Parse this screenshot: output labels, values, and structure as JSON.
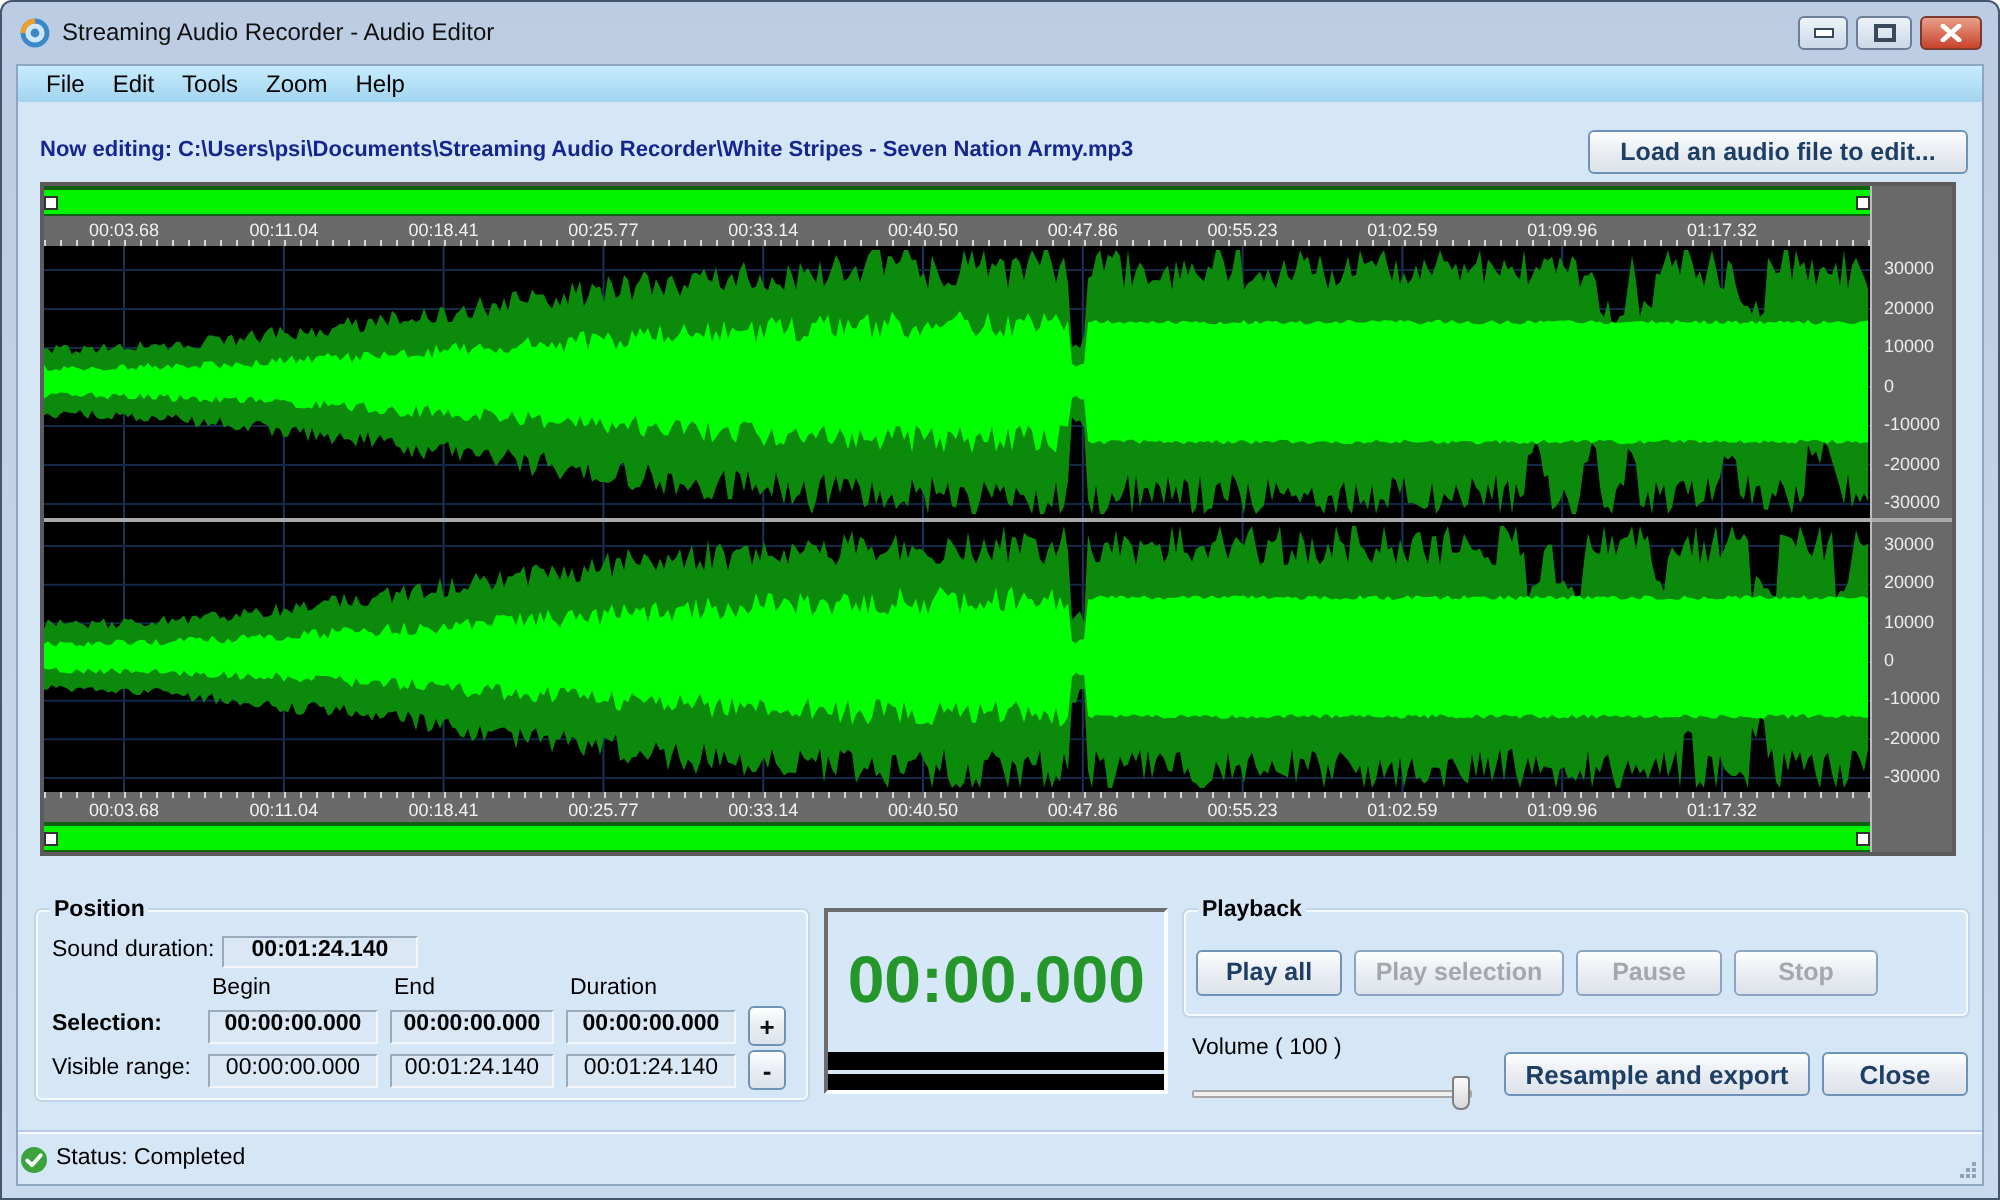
{
  "window": {
    "title": "Streaming Audio Recorder - Audio Editor"
  },
  "menu": [
    "File",
    "Edit",
    "Tools",
    "Zoom",
    "Help"
  ],
  "editing_label": "Now editing: C:\\Users\\psi\\Documents\\Streaming Audio Recorder\\White Stripes - Seven Nation Army.mp3",
  "load_button": "Load an audio file to edit...",
  "waveform": {
    "top_ruler": [
      "00:03.68",
      "00:11.04",
      "00:18.41",
      "00:25.77",
      "00:33.14",
      "00:40.50",
      "00:47.86",
      "00:55.23",
      "01:02.59",
      "01:09.96",
      "01:17.32"
    ],
    "channels": [
      {
        "scale": [
          "30000",
          "20000",
          "10000",
          "0",
          "-10000",
          "-20000",
          "-30000"
        ]
      },
      {
        "scale": [
          "30000",
          "20000",
          "10000",
          "0",
          "-10000",
          "-20000",
          "-30000"
        ]
      }
    ],
    "bottom_ruler": [
      "00:03.68",
      "00:11.04",
      "00:18.41",
      "00:25.77",
      "00:33.14",
      "00:40.50",
      "00:47.86",
      "00:55.23",
      "01:02.59",
      "01:09.96",
      "01:17.32"
    ]
  },
  "position": {
    "title": "Position",
    "sound_duration": {
      "label": "Sound duration:",
      "value": "00:01:24.140"
    },
    "columns": [
      "Begin",
      "End",
      "Duration"
    ],
    "selection": {
      "label": "Selection:",
      "values": [
        "00:00:00.000",
        "00:00:00.000",
        "00:00:00.000"
      ]
    },
    "visible_range": {
      "label": "Visible range:",
      "values": [
        "00:00:00.000",
        "00:01:24.140",
        "00:01:24.140"
      ]
    },
    "zoom_buttons": [
      "+",
      "-"
    ]
  },
  "timer": {
    "value": "00:00.000"
  },
  "playback": {
    "title": "Playback",
    "buttons": [
      {
        "label": "Play all",
        "disabled": false
      },
      {
        "label": "Play selection",
        "disabled": true
      },
      {
        "label": "Pause",
        "disabled": true
      },
      {
        "label": "Stop",
        "disabled": true
      }
    ]
  },
  "volume": {
    "label": "Volume ( 100 )",
    "level": 1
  },
  "actions": [
    "Resample and export",
    "Close"
  ],
  "status_bar": {
    "text": "Status: Completed"
  }
}
